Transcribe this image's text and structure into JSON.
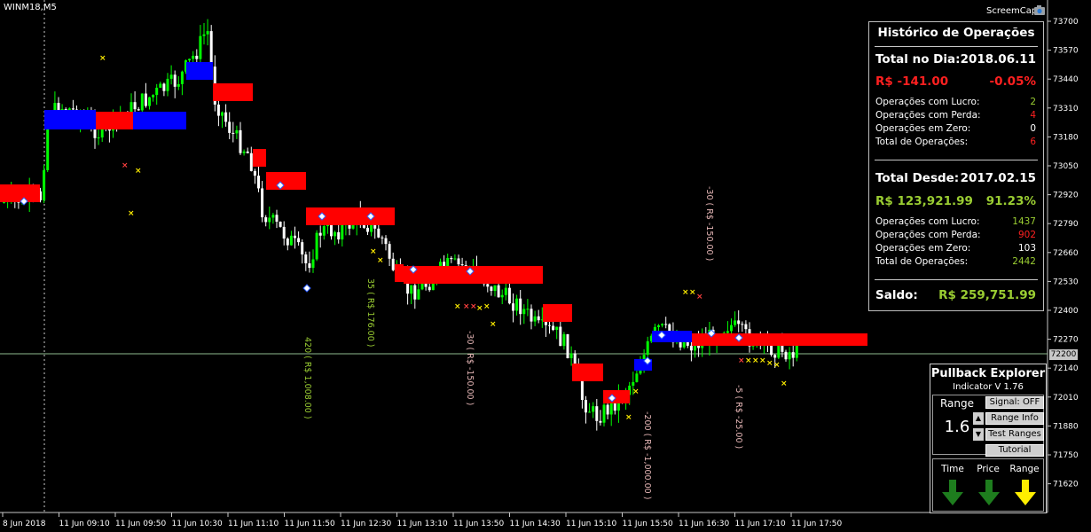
{
  "symbol_label": "WINM18,M5",
  "screencap_label": "ScreemCap",
  "current_price_label": "72200",
  "colors": {
    "up": "#00ff00",
    "down": "#ffffff",
    "band_red": "#ff0000",
    "band_blue": "#0000ff",
    "profit": "#9acd32",
    "loss": "#ff2020"
  },
  "price_axis": {
    "labels": [
      "73700",
      "73570",
      "73440",
      "73310",
      "73180",
      "73050",
      "72920",
      "72790",
      "72660",
      "72530",
      "72400",
      "72270",
      "72140",
      "72010",
      "71880",
      "71750",
      "71620"
    ]
  },
  "time_axis": {
    "labels": [
      "8 Jun 2018",
      "11 Jun 09:10",
      "11 Jun 09:50",
      "11 Jun 10:30",
      "11 Jun 11:10",
      "11 Jun 11:50",
      "11 Jun 12:30",
      "11 Jun 13:10",
      "11 Jun 13:50",
      "11 Jun 14:30",
      "11 Jun 15:10",
      "11 Jun 15:50",
      "11 Jun 16:30",
      "11 Jun 17:10",
      "11 Jun 17:50"
    ]
  },
  "trade_annotations": [
    {
      "text": "420 ( R$ 1,008.00 )",
      "color": "profit"
    },
    {
      "text": "35 ( R$ 176.00 )",
      "color": "profit"
    },
    {
      "text": "-30 ( R$ -150.00 )",
      "color": "loss"
    },
    {
      "text": "-30 ( R$ -150.00 )",
      "color": "loss"
    },
    {
      "text": "-200 ( R$ -1,000.00 )",
      "color": "loss"
    },
    {
      "text": "-5 ( R$ -25.00 )",
      "color": "loss"
    }
  ],
  "history": {
    "title": "Histórico de Operações",
    "day_label": "Total no Dia:",
    "day_date": "2018.06.11",
    "day_value": "R$ -141.00",
    "day_percent": "-0.05%",
    "day_rows": [
      {
        "label": "Operações com Lucro:",
        "value": "2",
        "color": "profit"
      },
      {
        "label": "Operações com Perda:",
        "value": "4",
        "color": "loss"
      },
      {
        "label": "Operações em Zero:",
        "value": "0",
        "color": "white"
      },
      {
        "label": "Total de Operações:",
        "value": "6",
        "color": "loss"
      }
    ],
    "since_label": "Total Desde:",
    "since_date": "2017.02.15",
    "since_value": "R$ 123,921.99",
    "since_percent": "91.23%",
    "since_rows": [
      {
        "label": "Operações com Lucro:",
        "value": "1437",
        "color": "profit"
      },
      {
        "label": "Operações com Perda:",
        "value": "902",
        "color": "loss"
      },
      {
        "label": "Operações em Zero:",
        "value": "103",
        "color": "white"
      },
      {
        "label": "Total de Operações:",
        "value": "2442",
        "color": "profit"
      }
    ],
    "balance_label": "Saldo:",
    "balance_value": "R$ 259,751.99"
  },
  "pullback": {
    "title": "Pullback Explorer",
    "subtitle": "Indicator V 1.76",
    "range_label": "Range",
    "range_value": "1.6",
    "buttons": [
      "Signal: OFF",
      "Range Info",
      "Test Ranges",
      "Tutorial"
    ],
    "signals": [
      {
        "label": "Time",
        "direction": "down",
        "color": "green"
      },
      {
        "label": "Price",
        "direction": "down",
        "color": "green"
      },
      {
        "label": "Range",
        "direction": "down",
        "color": "yellow"
      }
    ]
  }
}
